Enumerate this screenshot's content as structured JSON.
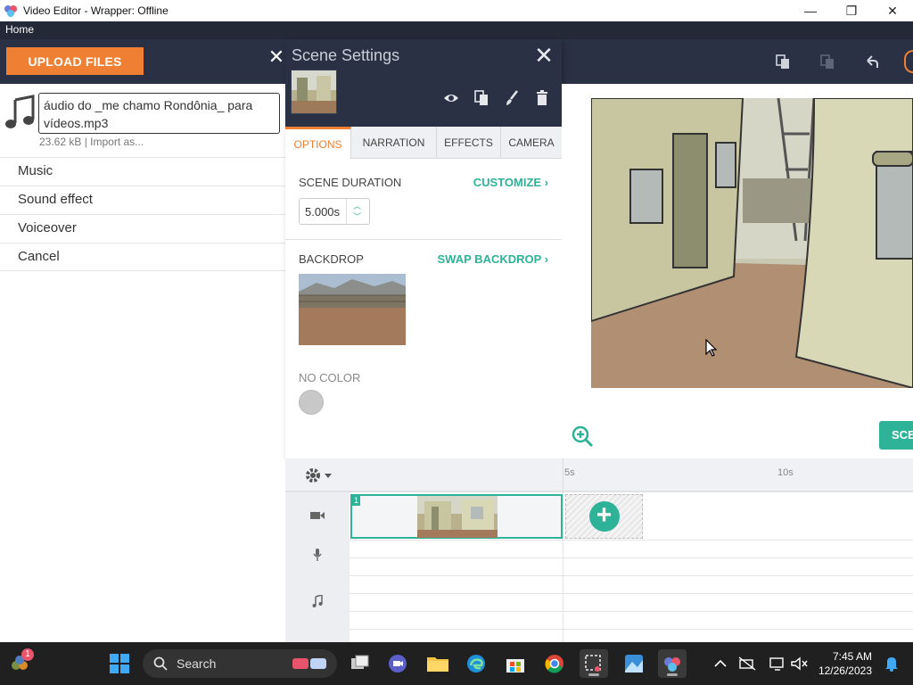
{
  "window": {
    "title": "Video Editor - Wrapper: Offline",
    "minimize_glyph": "—",
    "restore_glyph": "❐",
    "close_glyph": "✕"
  },
  "menu": {
    "home_label": "Home"
  },
  "left_panel": {
    "upload_label": "UPLOAD FILES",
    "file": {
      "name": "áudio do _me chamo Rondônia_ para vídeos.mp3",
      "meta": "23.62 kB | Import as..."
    },
    "import_options": [
      "Music",
      "Sound effect",
      "Voiceover",
      "Cancel"
    ]
  },
  "scene_settings": {
    "title": "Scene Settings",
    "close_glyph": "✕",
    "outer_close_glyph": "✕",
    "tabs": [
      "OPTIONS",
      "NARRATION",
      "EFFECTS",
      "CAMERA"
    ],
    "active_tab": "OPTIONS",
    "duration_label": "SCENE DURATION",
    "customize_label": "CUSTOMIZE ›",
    "duration_value": "5.000s",
    "backdrop_label": "BACKDROP",
    "swap_backdrop_label": "SWAP BACKDROP ›",
    "color_label": "NO COLOR"
  },
  "canvas": {
    "scene_button_label": "SCE"
  },
  "timeline": {
    "ticks": [
      "5s",
      "10s"
    ],
    "clip_number": "1",
    "add_glyph": "+"
  },
  "taskbar": {
    "search_placeholder": "Search",
    "time": "7:45 AM",
    "date": "12/26/2023",
    "notification_count": "1"
  },
  "colors": {
    "accent_orange": "#ef7f32",
    "accent_teal": "#2eb398",
    "header_navy": "#2a3144",
    "menubar": "#232937"
  }
}
